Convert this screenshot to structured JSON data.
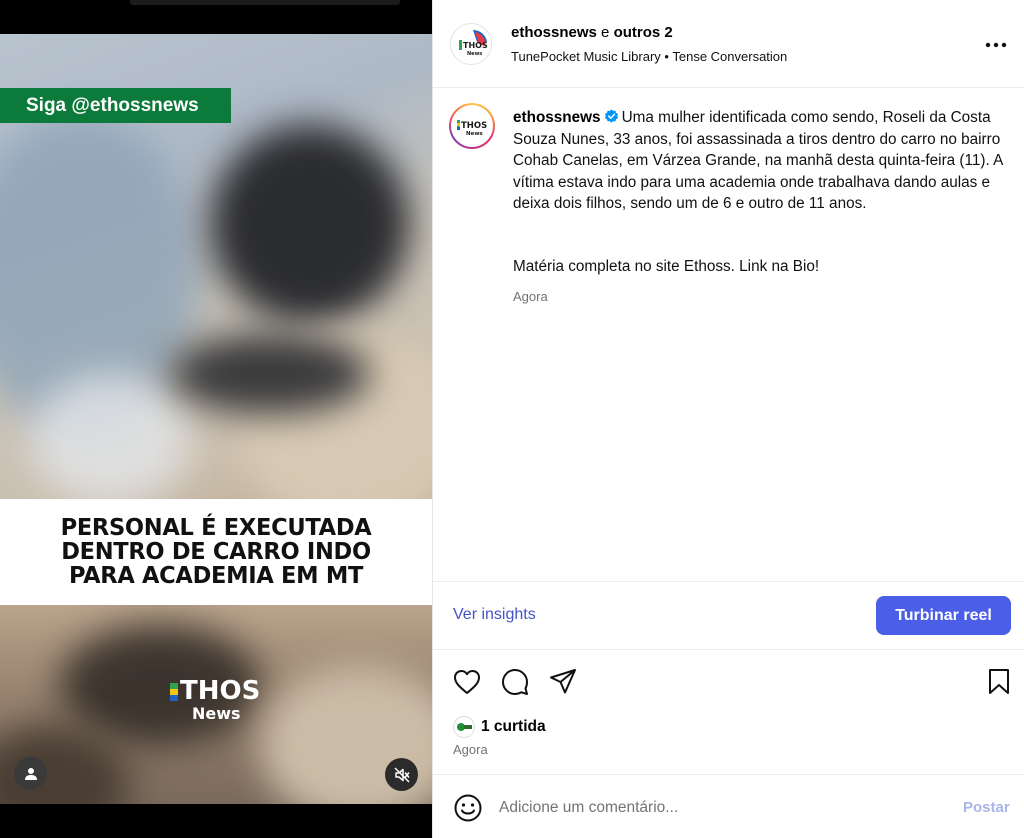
{
  "media": {
    "follow_banner": "Siga @ethossnews",
    "headline": "PERSONAL É EXECUTADA DENTRO DE CARRO INDO PARA ACADEMIA EM MT",
    "logo_word": "THOS",
    "logo_sub": "News",
    "user_icon": "user-icon",
    "mute_icon": "speaker-muted-icon"
  },
  "header": {
    "username": "ethossnews",
    "collab_connector": " e ",
    "collab_others": "outros 2",
    "music_artist": "TunePocket Music Library",
    "music_separator": " • ",
    "music_track": "Tense Conversation",
    "avatar_text": "THOS",
    "avatar_sub": "News"
  },
  "caption": {
    "username": "ethossnews",
    "text": "Uma mulher identificada como sendo, Roseli da Costa Souza Nunes, 33 anos, foi assassinada a tiros dentro do carro no bairro Cohab Canelas, em Várzea Grande, na manhã desta quinta-feira (11). A vítima estava indo para uma academia onde trabalhava dando aulas e deixa dois filhos, sendo um de 6 e outro de 11 anos.",
    "text2": "Matéria completa no site Ethoss. Link na Bio!",
    "time": "Agora"
  },
  "insights": {
    "link": "Ver insights",
    "boost_button": "Turbinar reel"
  },
  "actions": {
    "like_icon": "heart-icon",
    "comment_icon": "comment-icon",
    "share_icon": "send-icon",
    "save_icon": "bookmark-icon"
  },
  "likes": {
    "count_text": "1 curtida",
    "time": "Agora"
  },
  "comment": {
    "placeholder": "Adicione um comentário...",
    "post_button": "Postar"
  },
  "colors": {
    "accent": "#4a5ee8",
    "link": "#4354c4",
    "follow_banner": "#0c7a3a"
  }
}
